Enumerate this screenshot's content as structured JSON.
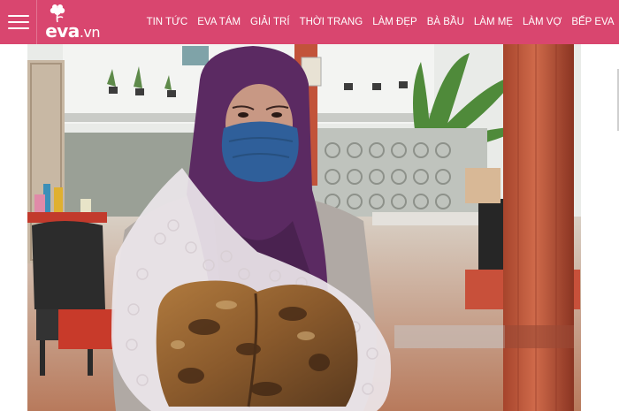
{
  "header": {
    "logo": {
      "text": "eva",
      "suffix": ".vn"
    },
    "nav": [
      {
        "label": "TIN TỨC"
      },
      {
        "label": "EVA TÁM"
      },
      {
        "label": "GIẢI TRÍ"
      },
      {
        "label": "THỜI TRANG"
      },
      {
        "label": "LÀM ĐẸP"
      },
      {
        "label": "BÀ BẦU"
      },
      {
        "label": "LÀM MẸ"
      },
      {
        "label": "LÀM VỢ"
      },
      {
        "label": "BẾP EVA"
      }
    ]
  },
  "colors": {
    "brand": "#d9466f",
    "header_text": "#ffffff"
  },
  "icons": {
    "menu": "hamburger-menu-icon",
    "logo_mark": "flower-logo-icon"
  }
}
